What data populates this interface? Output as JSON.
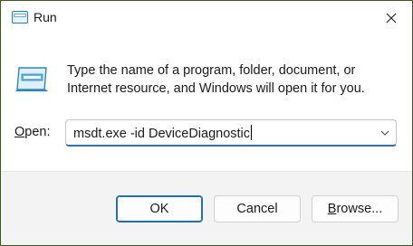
{
  "window": {
    "title": "Run",
    "title_icon": "run-icon",
    "close_icon": "close-icon",
    "border_color": "#3c5a14"
  },
  "content": {
    "icon": "run-app-icon",
    "description": "Type the name of a program, folder, document, or Internet resource, and Windows will open it for you.",
    "open_label_underlined": "O",
    "open_label_rest": "pen:",
    "command_value": "msdt.exe -id DeviceDiagnostic",
    "dropdown_icon": "chevron-down-icon"
  },
  "buttons": {
    "ok": "OK",
    "cancel": "Cancel",
    "browse_underlined": "B",
    "browse_rest": "rowse..."
  },
  "colors": {
    "accent": "#1f6fb5",
    "footer_bg": "#f3f3f3"
  }
}
